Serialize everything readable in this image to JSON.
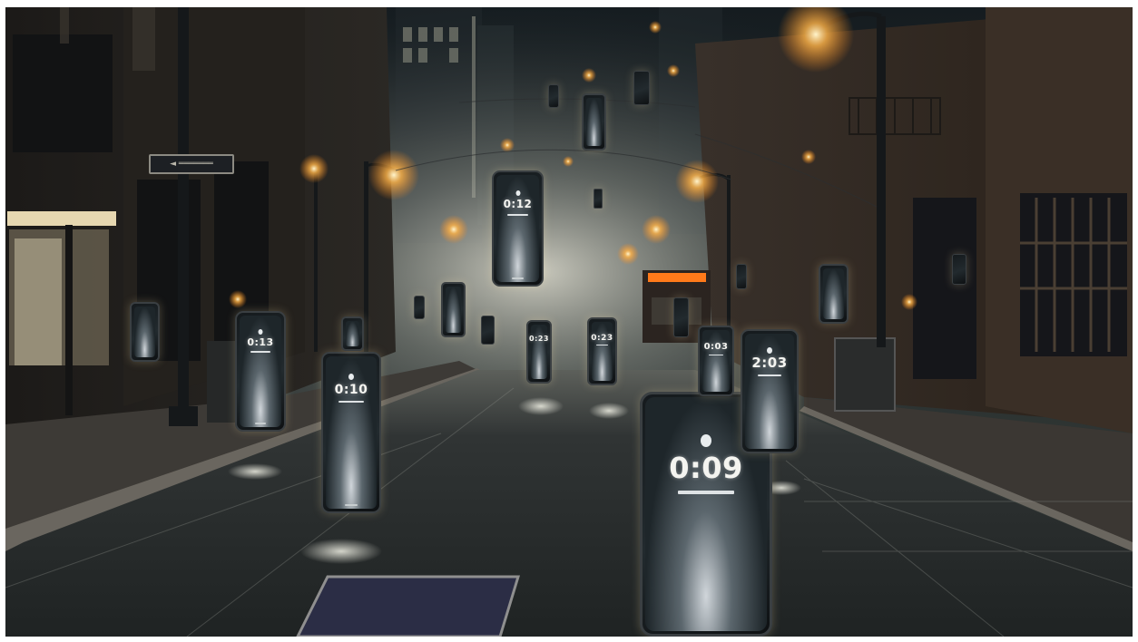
{
  "scene": {
    "description_type": "photo-illustration",
    "colors": {
      "sky": "#1a2328",
      "street": "#2a2e2f",
      "lamp_glow": "#ffb347",
      "building": "#231d19",
      "bus_light": "#ff7a1a"
    }
  },
  "street_sign": {
    "text": "◄ ═══════"
  },
  "phones": [
    {
      "time": "0:12"
    },
    {
      "time": "0:13"
    },
    {
      "time": "0:10"
    },
    {
      "time": "0:09"
    },
    {
      "time": "2:03"
    },
    {
      "time": "0:23"
    },
    {
      "time": "0:23"
    },
    {
      "time": "0:03"
    },
    {
      "time": ""
    },
    {
      "time": ""
    },
    {
      "time": ""
    },
    {
      "time": ""
    },
    {
      "time": ""
    }
  ]
}
